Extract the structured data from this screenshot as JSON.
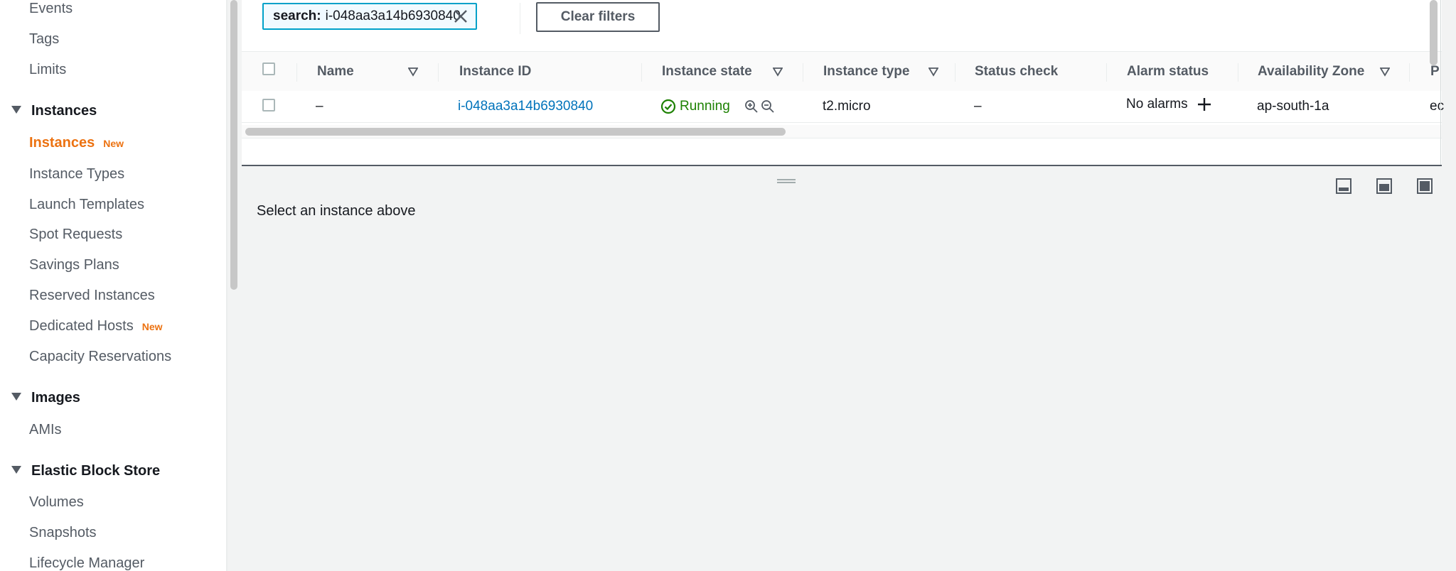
{
  "sidebar": {
    "items": [
      {
        "label": "Events"
      },
      {
        "label": "Tags"
      },
      {
        "label": "Limits"
      }
    ],
    "sections": [
      {
        "label": "Instances",
        "items": [
          {
            "label": "Instances",
            "badge": "New",
            "active": true
          },
          {
            "label": "Instance Types"
          },
          {
            "label": "Launch Templates"
          },
          {
            "label": "Spot Requests"
          },
          {
            "label": "Savings Plans"
          },
          {
            "label": "Reserved Instances"
          },
          {
            "label": "Dedicated Hosts",
            "badge": "New"
          },
          {
            "label": "Capacity Reservations"
          }
        ]
      },
      {
        "label": "Images",
        "items": [
          {
            "label": "AMIs"
          }
        ]
      },
      {
        "label": "Elastic Block Store",
        "items": [
          {
            "label": "Volumes"
          },
          {
            "label": "Snapshots"
          },
          {
            "label": "Lifecycle Manager"
          }
        ]
      }
    ]
  },
  "filter": {
    "key": "search:",
    "value": "i-048aa3a14b6930840",
    "clear_label": "Clear filters"
  },
  "table": {
    "columns": [
      "Name",
      "Instance ID",
      "Instance state",
      "Instance type",
      "Status check",
      "Alarm status",
      "Availability Zone",
      "P"
    ],
    "rows": [
      {
        "name": "–",
        "instance_id": "i-048aa3a14b6930840",
        "state": "Running",
        "type": "t2.micro",
        "status_check": "–",
        "alarm": "No alarms",
        "zone": "ap-south-1a",
        "public": "ec"
      }
    ]
  },
  "details": {
    "empty_message": "Select an instance above"
  },
  "colors": {
    "accent": "#ec7211",
    "link": "#0073bb",
    "success": "#1d8102",
    "filter_border": "#00a1c9"
  }
}
